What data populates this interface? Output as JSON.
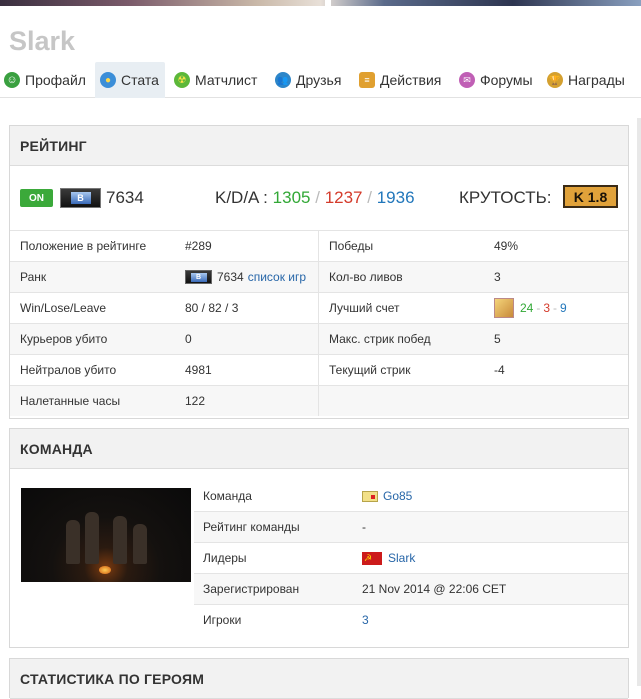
{
  "page": {
    "title": "Slark"
  },
  "tabs": [
    {
      "label": "Профайл",
      "icon": "smile-icon",
      "color": "#3aa040"
    },
    {
      "label": "Стата",
      "icon": "stats-icon",
      "color": "#3b8ed8",
      "active": true
    },
    {
      "label": "Матчлист",
      "icon": "radiation-icon",
      "color": "#5cb83a"
    },
    {
      "label": "Друзья",
      "icon": "friends-icon",
      "color": "#2d86c9"
    },
    {
      "label": "Действия",
      "icon": "notepad-icon",
      "color": "#e0a030"
    },
    {
      "label": "Форумы",
      "icon": "forum-icon",
      "color": "#c05fb5"
    },
    {
      "label": "Награды",
      "icon": "trophy-icon",
      "color": "#d4a030"
    }
  ],
  "rating": {
    "heading": "РЕЙТИНГ",
    "status": "ON",
    "rank_letter": "B",
    "rating": "7634",
    "kda_label": "K/D/A :",
    "kills": "1305",
    "deaths": "1237",
    "assists": "1936",
    "separator": "/",
    "coolness_label": "КРУТОСТЬ:",
    "coolness_value": "K 1.8",
    "rows": [
      {
        "l1": "Положение в рейтинге",
        "v1": "#289",
        "l2": "Победы",
        "v2": "49%"
      },
      {
        "l1": "Ранк",
        "v1": "7634",
        "v1_link": "список игр",
        "l2": "Кол-во ливов",
        "v2": "3"
      },
      {
        "l1": "Win/Lose/Leave",
        "v1": "80 / 82 / 3",
        "l2": "Лучший счет",
        "v2_k": "24",
        "v2_d": "3",
        "v2_a": "9",
        "v2_sep": "-"
      },
      {
        "l1": "Курьеров убито",
        "v1": "0",
        "l2": "Макс. стрик побед",
        "v2": "5"
      },
      {
        "l1": "Нейтралов убито",
        "v1": "4981",
        "l2": "Текущий стрик",
        "v2": "-4"
      },
      {
        "l1": "Налетанные часы",
        "v1": "122",
        "l2": "",
        "v2": ""
      }
    ]
  },
  "team": {
    "heading": "КОМАНДА",
    "rows": [
      {
        "label": "Команда",
        "value": "Go85"
      },
      {
        "label": "Рейтинг команды",
        "value": "-"
      },
      {
        "label": "Лидеры",
        "value": "Slark"
      },
      {
        "label": "Зарегистрирован",
        "value": "21 Nov 2014 @ 22:06 CET"
      },
      {
        "label": "Игроки",
        "value": "3"
      }
    ]
  },
  "heroes": {
    "heading": "СТАТИСТИКА ПО ГЕРОЯМ"
  }
}
